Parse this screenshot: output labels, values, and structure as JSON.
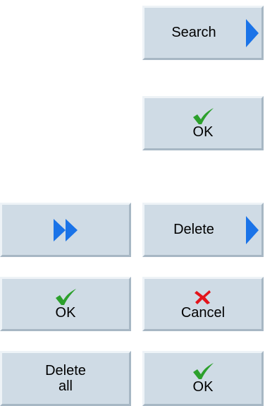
{
  "softkeys": {
    "search": {
      "label": "Search",
      "icon": "arrow-right-icon"
    },
    "ok_1": {
      "label": "OK",
      "icon": "checkmark-icon"
    },
    "forward": {
      "icon": "double-arrow-right-icon"
    },
    "delete": {
      "label": "Delete",
      "icon": "arrow-right-icon"
    },
    "ok_2": {
      "label": "OK",
      "icon": "checkmark-icon"
    },
    "cancel": {
      "label": "Cancel",
      "icon": "cross-icon"
    },
    "delete_all": {
      "label_line1": "Delete",
      "label_line2": "all"
    },
    "ok_3": {
      "label": "OK",
      "icon": "checkmark-icon"
    }
  },
  "colors": {
    "button_face": "#cfdbe5",
    "arrow": "#1a73e8",
    "check": "#2ca02c",
    "cross": "#e3141b"
  }
}
